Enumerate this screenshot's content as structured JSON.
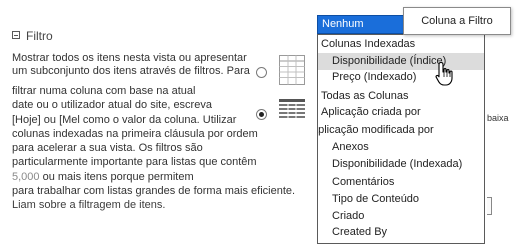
{
  "section": {
    "title": "Filtro",
    "description_lines": [
      "Mostrar todos os itens nesta vista ou apresentar",
      "um subconjunto dos itens através de filtros. Para",
      "filtrar numa coluna com base na atual",
      "date ou o utilizador atual do site, escreva",
      "[Hoje] ou [Mel como o valor da coluna. Utilizar",
      "colunas indexadas na primeira cláusula por ordem",
      "para acelerar a sua vista. Os filtros são",
      "particularmente importante para listas que contêm",
      "5,000",
      "ou mais itens porque permitem",
      "para trabalhar com listas grandes de forma mais eficiente.",
      "Liam sobre a filtragem de itens."
    ]
  },
  "filter_options": {
    "show_all_selected": false,
    "show_filtered_selected": true
  },
  "dropdown": {
    "selected": "Nenhum",
    "groups": [
      {
        "label": "Colunas Indexadas",
        "items": [
          "Disponibilidade (Índice)",
          "Preço (Indexado)"
        ]
      },
      {
        "label": "Todas as Colunas",
        "items": [
          "Aplicação criada por",
          "aplicação modificada por",
          "Anexos",
          "Disponibilidade (Indexada)",
          "Comentários",
          "Tipo de Conteúdo",
          "Criado",
          "Created By"
        ]
      }
    ],
    "hovered_item": "Disponibilidade (Índice)"
  },
  "tooltip": {
    "text": "Coluna a Filtro"
  },
  "partial_right_text": "baixa",
  "colors": {
    "accent": "#1a6eda",
    "hover_row": "#dcdcdc"
  }
}
